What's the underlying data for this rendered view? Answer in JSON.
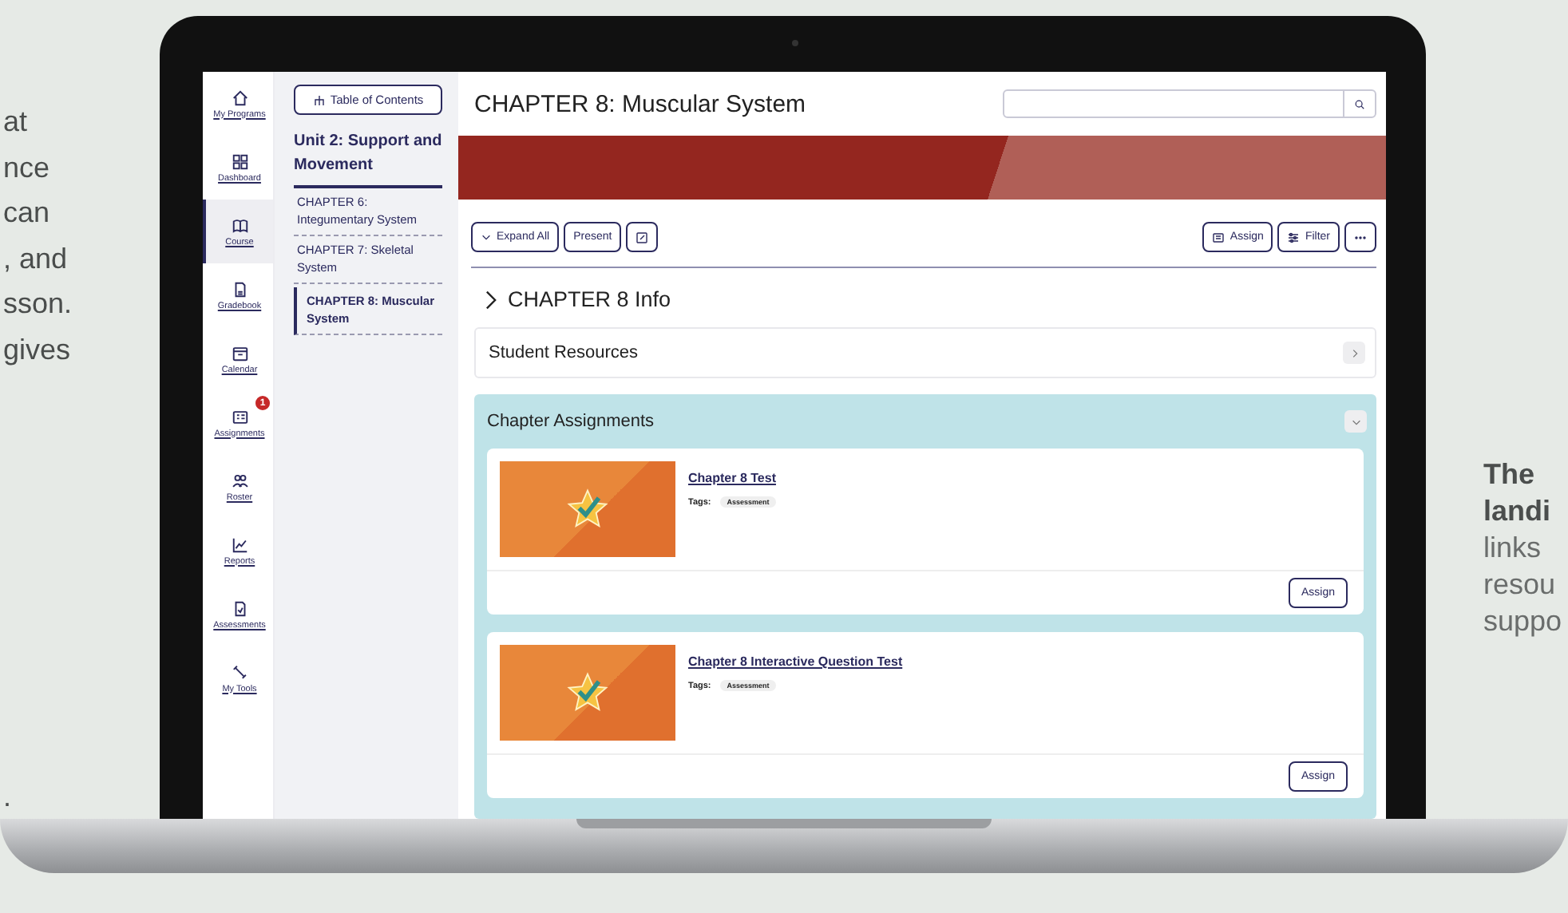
{
  "side_text_left": [
    "at",
    "nce",
    "can",
    ", and",
    "sson.",
    "gives",
    "."
  ],
  "nav_rail": [
    {
      "label": "My Programs",
      "selected": false
    },
    {
      "label": "Dashboard",
      "selected": false
    },
    {
      "label": "Course",
      "selected": true
    },
    {
      "label": "Gradebook",
      "selected": false
    },
    {
      "label": "Calendar",
      "selected": false
    },
    {
      "label": "Assignments",
      "selected": false,
      "badge": "1"
    },
    {
      "label": "Roster",
      "selected": false
    },
    {
      "label": "Reports",
      "selected": false
    },
    {
      "label": "Assessments",
      "selected": false
    },
    {
      "label": "My Tools",
      "selected": false
    }
  ],
  "toc": {
    "button": "Table of Contents",
    "unit": "Unit 2: Support and Movement",
    "chapters": [
      {
        "label": "CHAPTER 6: Integumentary System",
        "selected": false
      },
      {
        "label": "CHAPTER 7: Skeletal System",
        "selected": false
      },
      {
        "label": "CHAPTER 8: Muscular System",
        "selected": true
      }
    ]
  },
  "page": {
    "title": "CHAPTER 8: Muscular System",
    "toolbar_left": [
      {
        "kind": "expand",
        "label": "Expand All"
      },
      {
        "kind": "text",
        "label": "Present"
      },
      {
        "kind": "edit"
      }
    ],
    "toolbar_right": [
      {
        "kind": "assign",
        "label": "Assign"
      },
      {
        "kind": "filter",
        "label": "Filter"
      },
      {
        "kind": "more"
      }
    ],
    "info_heading": {
      "label": "CHAPTER 8 Info",
      "expanded": false
    },
    "sections": [
      {
        "title": "Student Resources",
        "expanded": false
      },
      {
        "title": "Chapter Assignments",
        "expanded": true,
        "items": [
          {
            "title": "Chapter 8 Test",
            "tags_label": "Tags:",
            "tags": [
              "Assessment"
            ],
            "button": "Assign"
          },
          {
            "title": "Chapter 8 Interactive Question Test",
            "tags_label": "Tags:",
            "tags": [
              "Assessment"
            ],
            "button": "Assign"
          }
        ]
      }
    ]
  },
  "side_text_right": [
    {
      "text": "The",
      "bold": true
    },
    {
      "text": "landi",
      "bold": true
    },
    {
      "text": "links",
      "bold": false
    },
    {
      "text": "resou",
      "bold": false
    },
    {
      "text": "suppo",
      "bold": false
    }
  ]
}
